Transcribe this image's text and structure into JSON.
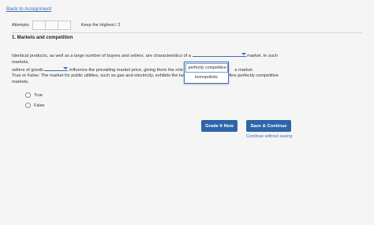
{
  "nav": {
    "back_label": "Back to Assignment"
  },
  "attempts": {
    "label": "Attempts",
    "keep_label": "Keep the Highest / 2"
  },
  "question": {
    "title": "1. Markets and competition",
    "p1_a": "Identical products, as well as a large number of buyers and sellers, are characteristics of a",
    "p1_b": "market. In such markets,",
    "p1_c": "sellers of goods",
    "p1_d": "influence the prevailing market price, giving them the role of",
    "p1_e": "e market.",
    "dropdown_options": [
      "perfectly competitive",
      "monopolistic"
    ],
    "p2_a": "True or False: The market for public utilities, such as gas and electricity, exhibits the two p",
    "p2_b": "at define perfectly competitive",
    "p2_c": "markets.",
    "choices": [
      "True",
      "False"
    ]
  },
  "actions": {
    "grade_label": "Grade It Now",
    "save_label": "Save & Continue",
    "continue_label": "Continue without saving"
  },
  "colors": {
    "accent": "#2d65a9",
    "link": "#3b6fb6"
  }
}
